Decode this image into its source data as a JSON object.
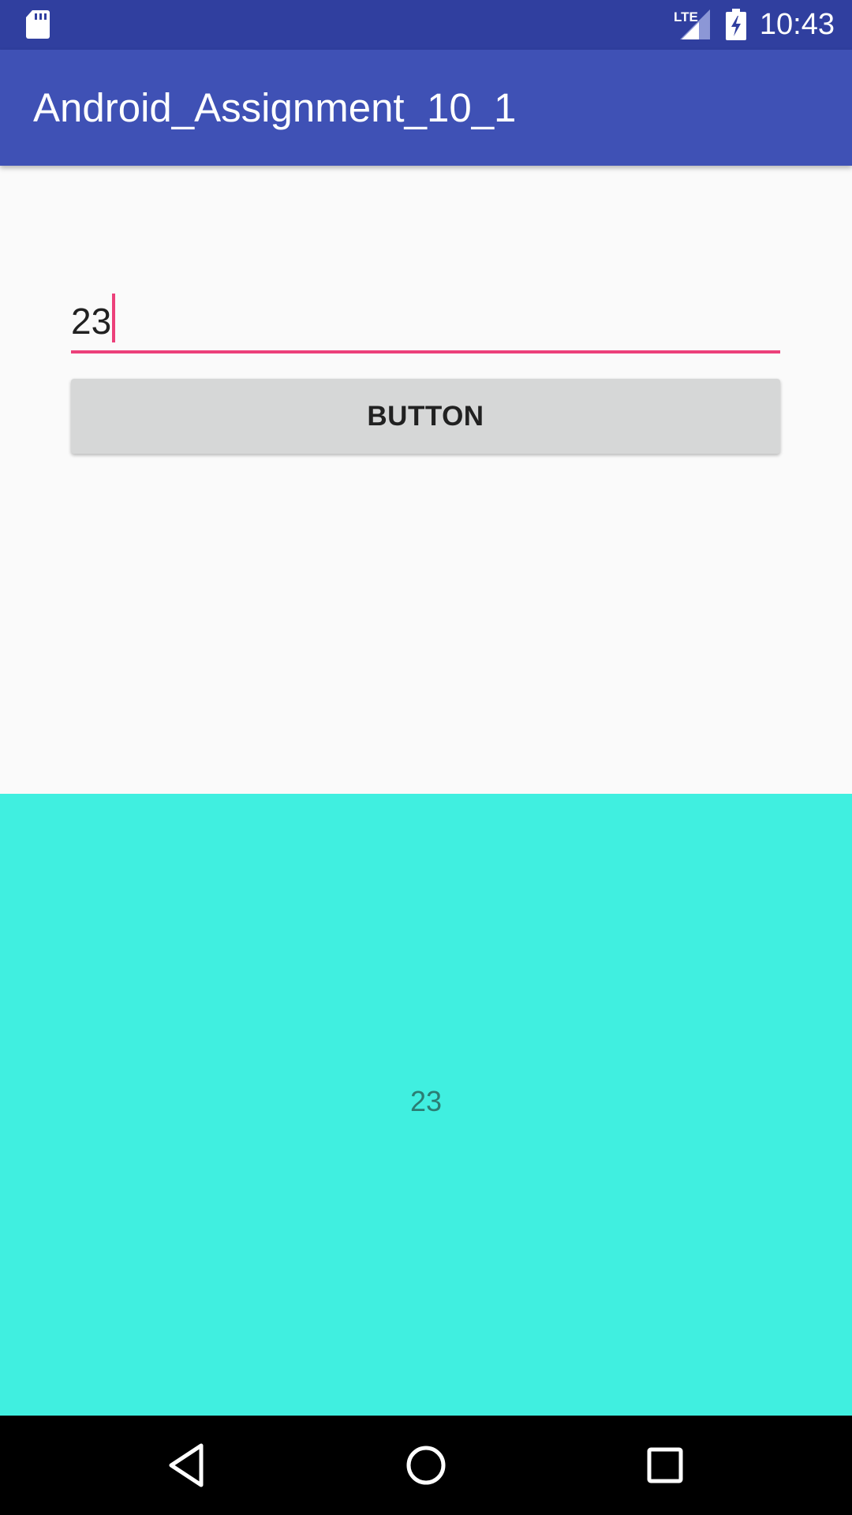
{
  "status_bar": {
    "time": "10:43",
    "network": "LTE",
    "icons": [
      "sd-card-icon",
      "lte-signal-icon",
      "battery-charging-icon"
    ],
    "background": "#303f9f"
  },
  "app_bar": {
    "title": "Android_Assignment_10_1",
    "background": "#3f51b5"
  },
  "input": {
    "value": "23",
    "accent": "#ec407a"
  },
  "button": {
    "label": "BUTTON"
  },
  "result": {
    "text": "23",
    "background": "#40efe0"
  },
  "nav_bar": {
    "icons": [
      "back-icon",
      "home-icon",
      "recents-icon"
    ]
  }
}
